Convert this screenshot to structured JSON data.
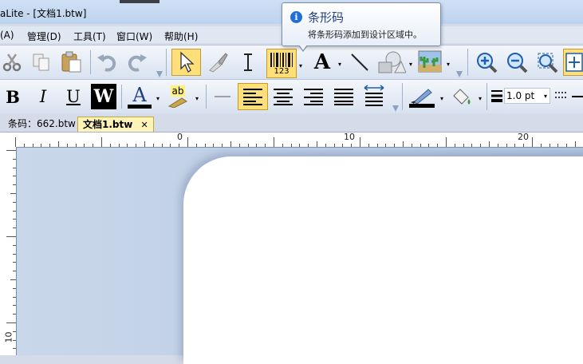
{
  "window": {
    "title": "aLite - [文档1.btw]"
  },
  "menu": {
    "items": [
      "(A)",
      "管理(D)",
      "工具(T)",
      "窗口(W)",
      "帮助(H)"
    ]
  },
  "tooltip": {
    "title": "条形码",
    "description": "将条形码添加到设计区域中。",
    "info_icon": "i"
  },
  "toolbar1": {
    "barcode_digits": "123",
    "text_tool": "A"
  },
  "toolbar2": {
    "bold": "B",
    "italic": "I",
    "underline": "U",
    "wordart": "W",
    "font_color": "A",
    "highlight": "ab",
    "line_width": "1.0 pt"
  },
  "tabs": [
    {
      "label": "条码：662.btw",
      "active": false
    },
    {
      "label": "文档1.btw",
      "active": true,
      "close": "✕"
    }
  ],
  "ruler": {
    "h_labels": [
      "0",
      "10",
      "20"
    ],
    "v_labels": [
      "10"
    ]
  },
  "colors": {
    "accent": "#ffdf7a",
    "info": "#1f6fd6",
    "paper": "#ffffff"
  }
}
